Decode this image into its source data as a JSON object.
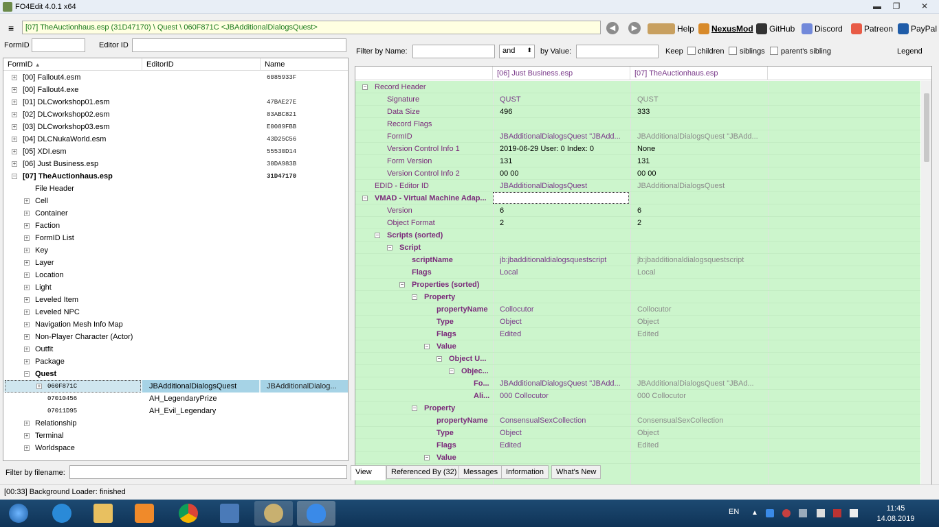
{
  "window": {
    "title": "FO4Edit 4.0.1 x64",
    "min": "▬",
    "max": "❐",
    "close": "✕"
  },
  "toolbar": {
    "path": "[07] TheAuctionhaus.esp (31D47170) \\ Quest \\ 060F871C <JBAdditionalDialogsQuest>",
    "links": [
      "Help",
      "NexusMod",
      "GitHub",
      "Discord",
      "Patreon",
      "PayPal"
    ],
    "back_glyph": "◀",
    "forward_glyph": "▶"
  },
  "left_filter": {
    "formid_label": "FormID",
    "editorid_label": "Editor ID"
  },
  "tree": {
    "headers": [
      "FormID",
      "EditorID",
      "Name"
    ],
    "sort_glyph": "▲",
    "files": [
      {
        "name": "[00] Fallout4.esm",
        "fid": "6085933F"
      },
      {
        "name": "[00] Fallout4.exe",
        "fid": ""
      },
      {
        "name": "[01] DLCworkshop01.esm",
        "fid": "47BAE27E"
      },
      {
        "name": "[02] DLCworkshop02.esm",
        "fid": "83ABC821"
      },
      {
        "name": "[03] DLCworkshop03.esm",
        "fid": "E0089FBB"
      },
      {
        "name": "[04] DLCNukaWorld.esm",
        "fid": "43D25C56"
      },
      {
        "name": "[05] XDI.esm",
        "fid": "55530D14"
      },
      {
        "name": "[06] Just Business.esp",
        "fid": "30DA983B"
      },
      {
        "name": "[07] TheAuctionhaus.esp",
        "fid": "31D47170"
      }
    ],
    "groups_before": [
      "File Header",
      "Cell",
      "Container",
      "Faction",
      "FormID List",
      "Key",
      "Layer",
      "Location",
      "Light",
      "Leveled Item",
      "Leveled NPC",
      "Navigation Mesh Info Map",
      "Non-Player Character (Actor)",
      "Outfit",
      "Package",
      "Quest"
    ],
    "quest_records": [
      {
        "fid": "060F871C",
        "eid": "JBAdditionalDialogsQuest",
        "name": "JBAdditionalDialog..."
      },
      {
        "fid": "07010456",
        "eid": "AH_LegendaryPrize",
        "name": ""
      },
      {
        "fid": "07011D95",
        "eid": "AH_Evil_Legendary",
        "name": ""
      }
    ],
    "groups_after": [
      "Relationship",
      "Terminal",
      "Worldspace"
    ]
  },
  "filename_filter": {
    "label": "Filter by filename:"
  },
  "right_filter": {
    "name_label": "Filter by Name:",
    "op": "and",
    "op_glyph": "⬍",
    "value_label": "by Value:",
    "keep": "Keep",
    "children": "children",
    "siblings": "siblings",
    "parents": "parent's sibling",
    "legend": "Legend"
  },
  "grid": {
    "headers": [
      "[06] Just Business.esp",
      "[07] TheAuctionhaus.esp"
    ],
    "rows": [
      {
        "label": "Record Header",
        "v1": "",
        "v2": "",
        "indent": 0,
        "toggle": "−",
        "bold": false
      },
      {
        "label": "Signature",
        "v1": "QUST",
        "v2": "QUST",
        "indent": 1
      },
      {
        "label": "Data Size",
        "v1": "496",
        "v2": "333",
        "indent": 1,
        "dark": true
      },
      {
        "label": "Record Flags",
        "v1": "",
        "v2": "",
        "indent": 1
      },
      {
        "label": "FormID",
        "v1": "JBAdditionalDialogsQuest \"JBAdd...",
        "v2": "JBAdditionalDialogsQuest \"JBAdd...",
        "indent": 1
      },
      {
        "label": "Version Control Info 1",
        "v1": "2019-06-29 User: 0 Index: 0",
        "v2": "None",
        "indent": 1,
        "dark": true
      },
      {
        "label": "Form Version",
        "v1": "131",
        "v2": "131",
        "indent": 1,
        "dark": true
      },
      {
        "label": "Version Control Info 2",
        "v1": "00 00",
        "v2": "00 00",
        "indent": 1,
        "dark": true
      },
      {
        "label": "EDID - Editor ID",
        "v1": "JBAdditionalDialogsQuest",
        "v2": "JBAdditionalDialogsQuest",
        "indent": 0
      },
      {
        "label": "VMAD - Virtual Machine Adap...",
        "v1": "",
        "v2": "",
        "indent": 0,
        "toggle": "−",
        "bold": true
      },
      {
        "label": "Version",
        "v1": "6",
        "v2": "6",
        "indent": 1,
        "dark": true
      },
      {
        "label": "Object Format",
        "v1": "2",
        "v2": "2",
        "indent": 1,
        "dark": true
      },
      {
        "label": "Scripts (sorted)",
        "v1": "",
        "v2": "",
        "indent": 1,
        "toggle": "−",
        "bold": true
      },
      {
        "label": "Script",
        "v1": "",
        "v2": "",
        "indent": 2,
        "toggle": "−",
        "bold": true
      },
      {
        "label": "scriptName",
        "v1": "jb:jbadditionaldialogsquestscript",
        "v2": "jb:jbadditionaldialogsquestscript",
        "indent": 3,
        "bold": true
      },
      {
        "label": "Flags",
        "v1": "Local",
        "v2": "Local",
        "indent": 3,
        "bold": true
      },
      {
        "label": "Properties (sorted)",
        "v1": "",
        "v2": "",
        "indent": 3,
        "toggle": "−",
        "bold": true
      },
      {
        "label": "Property",
        "v1": "",
        "v2": "",
        "indent": 4,
        "toggle": "−",
        "bold": true
      },
      {
        "label": "propertyName",
        "v1": "Collocutor",
        "v2": "Collocutor",
        "indent": 5,
        "bold": true
      },
      {
        "label": "Type",
        "v1": "Object",
        "v2": "Object",
        "indent": 5,
        "bold": true
      },
      {
        "label": "Flags",
        "v1": "Edited",
        "v2": "Edited",
        "indent": 5,
        "bold": true
      },
      {
        "label": "Value",
        "v1": "",
        "v2": "",
        "indent": 5,
        "toggle": "−",
        "bold": true
      },
      {
        "label": "Object U...",
        "v1": "",
        "v2": "",
        "indent": 6,
        "toggle": "−",
        "bold": true
      },
      {
        "label": "Objec...",
        "v1": "",
        "v2": "",
        "indent": 7,
        "toggle": "−",
        "bold": true
      },
      {
        "label": "Fo...",
        "v1": "JBAdditionalDialogsQuest \"JBAdd...",
        "v2": "JBAdditionalDialogsQuest \"JBAd...",
        "indent": 8,
        "bold": true
      },
      {
        "label": "Ali...",
        "v1": "000 Collocutor",
        "v2": "000 Collocutor",
        "indent": 8,
        "bold": true
      },
      {
        "label": "Property",
        "v1": "",
        "v2": "",
        "indent": 4,
        "toggle": "−",
        "bold": true
      },
      {
        "label": "propertyName",
        "v1": "ConsensualSexCollection",
        "v2": "ConsensualSexCollection",
        "indent": 5,
        "bold": true
      },
      {
        "label": "Type",
        "v1": "Object",
        "v2": "Object",
        "indent": 5,
        "bold": true
      },
      {
        "label": "Flags",
        "v1": "Edited",
        "v2": "Edited",
        "indent": 5,
        "bold": true
      },
      {
        "label": "Value",
        "v1": "",
        "v2": "",
        "indent": 5,
        "toggle": "−",
        "bold": true
      }
    ]
  },
  "tabs": [
    "View",
    "Referenced By (32)",
    "Messages",
    "Information",
    "What's New"
  ],
  "status": "[00:33] Background Loader: finished",
  "taskbar": {
    "lang": "EN",
    "time": "11:45",
    "date": "14.08.2019",
    "tray_up": "▲"
  }
}
